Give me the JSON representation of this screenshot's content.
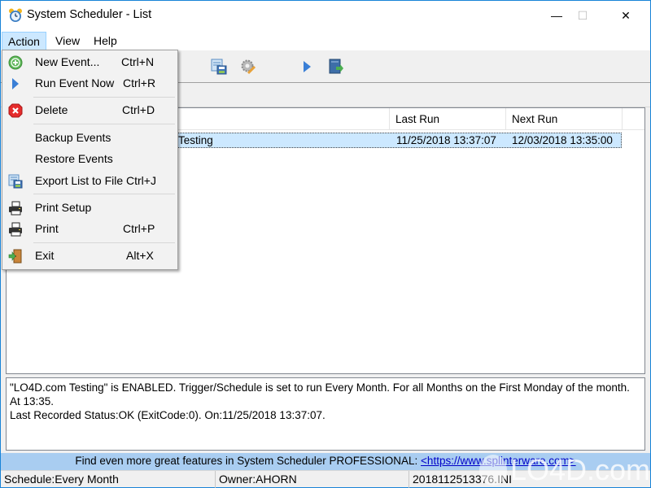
{
  "window": {
    "title": "System Scheduler - List",
    "controls": {
      "minimize": "—",
      "maximize": "☐",
      "close": "✕"
    }
  },
  "menubar": {
    "items": [
      {
        "label": "Action",
        "active": true
      },
      {
        "label": "View"
      },
      {
        "label": "Help"
      }
    ]
  },
  "toolbar": {
    "icons": [
      "export-list-icon",
      "settings-icon",
      "run-icon",
      "exit-icon"
    ]
  },
  "action_menu": {
    "items": [
      {
        "label": "New Event...",
        "shortcut": "Ctrl+N",
        "icon": "add-icon"
      },
      {
        "label": "Run Event Now",
        "shortcut": "Ctrl+R",
        "icon": "play-icon"
      },
      {
        "label": "Delete",
        "shortcut": "Ctrl+D",
        "icon": "delete-icon"
      },
      {
        "label": "Backup Events",
        "shortcut": ""
      },
      {
        "label": "Restore Events",
        "shortcut": ""
      },
      {
        "label": "Export List to File",
        "shortcut": "Ctrl+J",
        "icon": "export-icon"
      },
      {
        "label": "Print Setup",
        "shortcut": "",
        "icon": "printer-icon"
      },
      {
        "label": "Print",
        "shortcut": "Ctrl+P",
        "icon": "printer-icon"
      },
      {
        "label": "Exit",
        "shortcut": "Alt+X",
        "icon": "exit-door-icon"
      }
    ]
  },
  "list": {
    "columns": [
      "",
      "Last Run",
      "Next Run"
    ],
    "rows": [
      {
        "title": "LO4D.com Testing",
        "title_visible": "Testing",
        "last_run": "11/25/2018 13:37:07",
        "next_run": "12/03/2018 13:35:00",
        "selected": true
      }
    ]
  },
  "details": {
    "line1": "\"LO4D.com Testing\" is ENABLED. Trigger/Schedule is set to run Every Month. For all Months on the First Monday of the month. At 13:35.",
    "line2": "Last Recorded Status:OK (ExitCode:0). On:11/25/2018 13:37:07."
  },
  "promo": {
    "text": "Find even more great features in System Scheduler PROFESSIONAL: ",
    "link": "<https://www.splinterware.com>"
  },
  "statusbar": {
    "schedule": "Schedule:Every Month",
    "owner": "Owner:AHORN",
    "file": "2018112513376.INI"
  },
  "watermark": {
    "text": "LO4D.com"
  },
  "colors": {
    "accent": "#1883d7",
    "selection": "#cce8ff",
    "promo_bg": "#a9cdf1"
  }
}
